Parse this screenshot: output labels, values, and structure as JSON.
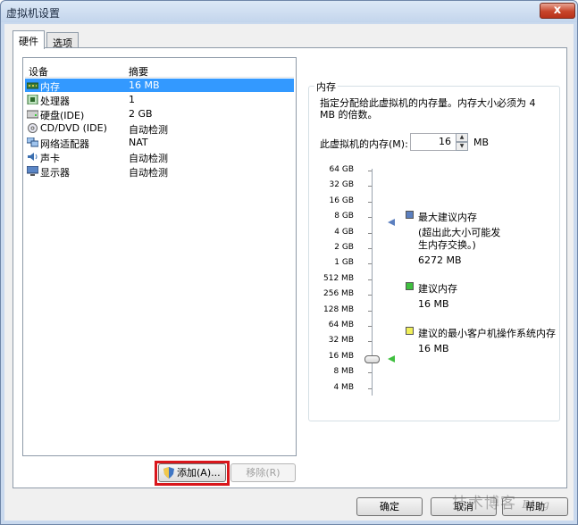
{
  "window": {
    "title": "虚拟机设置",
    "close_label": "x"
  },
  "tabs": [
    {
      "label": "硬件"
    },
    {
      "label": "选项"
    }
  ],
  "device_list": {
    "col_device": "设备",
    "col_summary": "摘要",
    "items": [
      {
        "name": "内存",
        "summary": "16 MB",
        "icon": "memory-icon"
      },
      {
        "name": "处理器",
        "summary": "1",
        "icon": "processor-icon"
      },
      {
        "name": "硬盘(IDE)",
        "summary": "2 GB",
        "icon": "hard-disk-icon"
      },
      {
        "name": "CD/DVD (IDE)",
        "summary": "自动检测",
        "icon": "cd-dvd-icon"
      },
      {
        "name": "网络适配器",
        "summary": "NAT",
        "icon": "network-adapter-icon"
      },
      {
        "name": "声卡",
        "summary": "自动检测",
        "icon": "sound-card-icon"
      },
      {
        "name": "显示器",
        "summary": "自动检测",
        "icon": "display-icon"
      }
    ]
  },
  "buttons": {
    "add": "添加(A)...",
    "remove": "移除(R)",
    "ok": "确定",
    "cancel": "取消",
    "help": "帮助"
  },
  "memory": {
    "group_title": "内存",
    "description": "指定分配给此虚拟机的内存量。内存大小必须为 4 MB 的倍数。",
    "field_label": "此虚拟机的内存(M):",
    "value": "16",
    "unit": "MB",
    "scale": [
      "64 GB",
      "32 GB",
      "16 GB",
      "8 GB",
      "4 GB",
      "2 GB",
      "1 GB",
      "512 MB",
      "256 MB",
      "128 MB",
      "64 MB",
      "32 MB",
      "16 MB",
      "8 MB",
      "4 MB"
    ],
    "max_recommended": {
      "title": "最大建议内存",
      "note": "(超出此大小可能发生内存交换。)",
      "value": "6272 MB",
      "color": "#5b7fbf"
    },
    "recommended": {
      "title": "建议内存",
      "value": "16 MB",
      "color": "#3fbf3f"
    },
    "guest_min": {
      "title": "建议的最小客户机操作系统内存",
      "value": "16 MB",
      "color": "#f0ef5a"
    }
  },
  "watermark": {
    "main": "技术博客",
    "sub": "Blog"
  }
}
